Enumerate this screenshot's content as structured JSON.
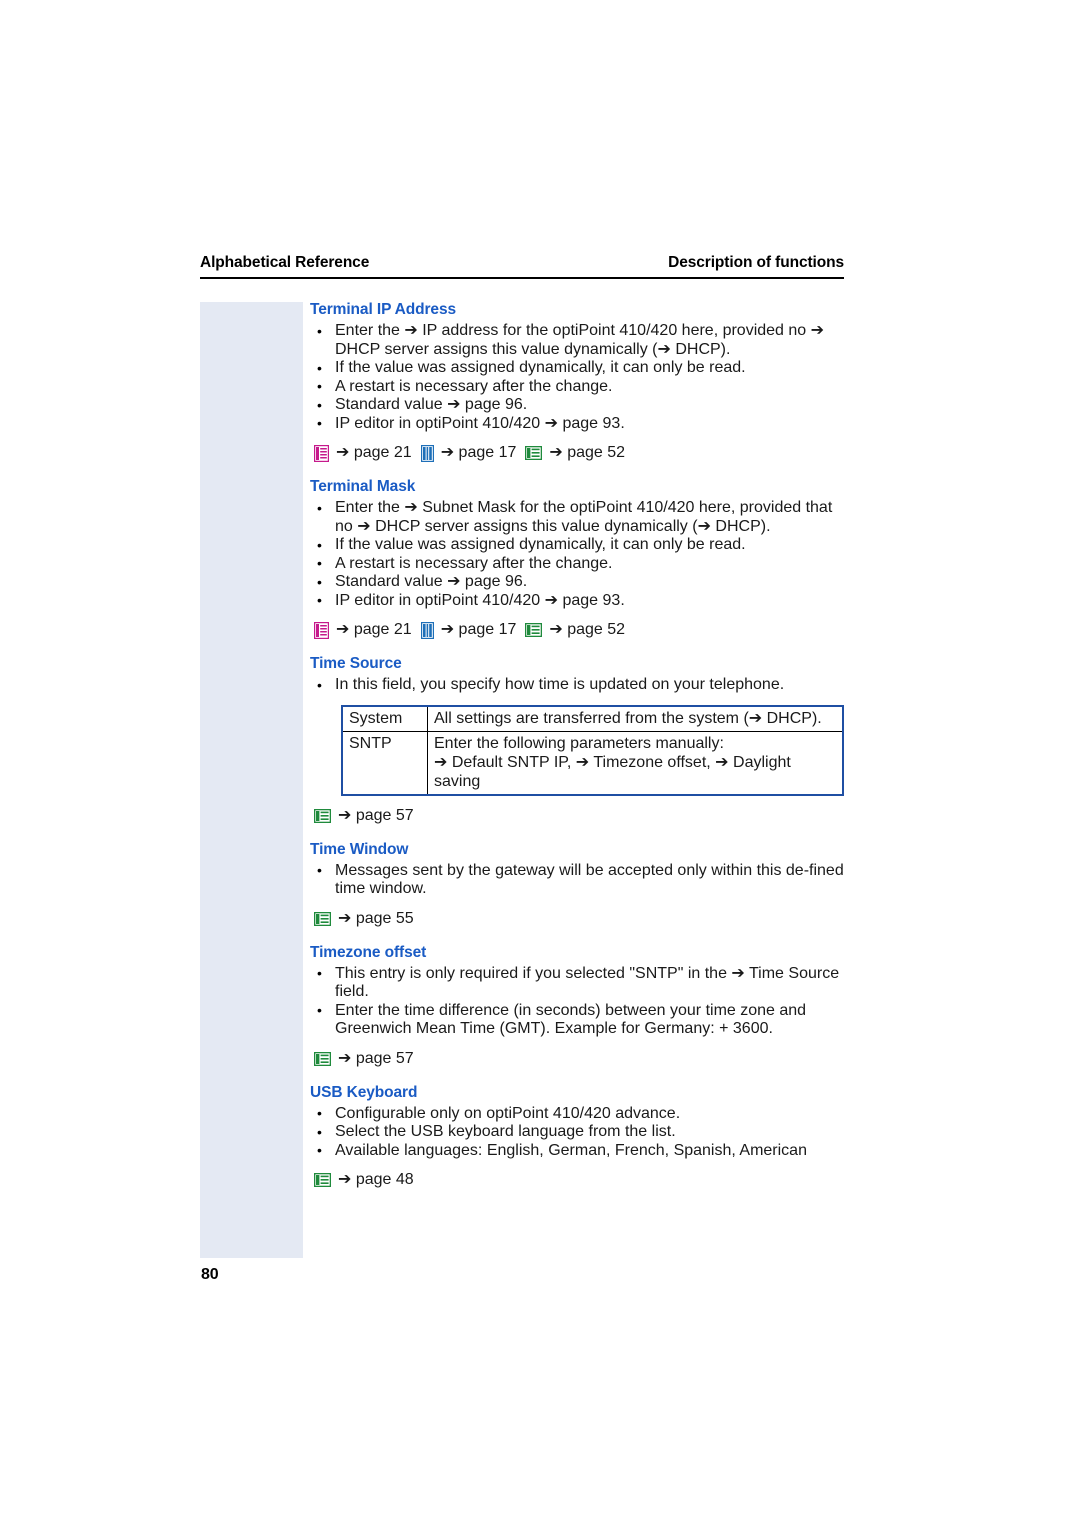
{
  "header": {
    "left": "Alphabetical Reference",
    "right": "Description of functions"
  },
  "folio": "80",
  "colors": {
    "heading_blue": "#1a5bc4",
    "margin_band": "#e4e9f3",
    "table_border": "#1f4fa3",
    "icon_magenta": "#c6198c",
    "icon_blue": "#1e6fb8",
    "icon_green": "#1f8a3c"
  },
  "sections": [
    {
      "title": "Terminal IP Address",
      "bullets": [
        "Enter the ➔ IP address for the optiPoint 410/420 here, provided no ➔ DHCP server assigns this value dynamically (➔ DHCP).",
        "If the value was assigned dynamically, it can only be read.",
        "A restart is necessary after the change.",
        "Standard value ➔ page 96.",
        "IP editor in optiPoint 410/420 ➔ page 93."
      ],
      "xrefs": [
        {
          "icon": "manual-magenta-icon",
          "text": "➔ page 21"
        },
        {
          "icon": "manual-blue-icon",
          "text": "➔ page 17"
        },
        {
          "icon": "manual-green-icon",
          "text": "➔ page 52"
        }
      ]
    },
    {
      "title": "Terminal Mask",
      "bullets": [
        "Enter the ➔ Subnet Mask for the optiPoint 410/420 here, provided that no ➔ DHCP server assigns this value dynamically (➔ DHCP).",
        "If the value was assigned dynamically, it can only be read.",
        "A restart is necessary after the change.",
        "Standard value ➔ page 96.",
        "IP editor in optiPoint 410/420 ➔ page 93."
      ],
      "xrefs": [
        {
          "icon": "manual-magenta-icon",
          "text": "➔ page 21"
        },
        {
          "icon": "manual-blue-icon",
          "text": "➔ page 17"
        },
        {
          "icon": "manual-green-icon",
          "text": "➔ page 52"
        }
      ]
    },
    {
      "title": "Time Source",
      "bullets": [
        "In this field, you specify how time is updated on your telephone."
      ],
      "table": {
        "rows": [
          {
            "key": "System",
            "value": "All settings are transferred from the system (➔ DHCP)."
          },
          {
            "key": "SNTP",
            "value": "Enter the following parameters manually:\n➔ Default SNTP IP, ➔ Timezone offset, ➔ Daylight saving"
          }
        ]
      },
      "xrefs": [
        {
          "icon": "manual-green-icon",
          "text": "➔ page 57"
        }
      ]
    },
    {
      "title": "Time Window",
      "bullets": [
        "Messages sent by the gateway will be accepted only within this de-fined time window."
      ],
      "xrefs": [
        {
          "icon": "manual-green-icon",
          "text": "➔ page 55"
        }
      ]
    },
    {
      "title": "Timezone offset",
      "bullets": [
        "This entry is only required if you selected \"SNTP\" in the ➔ Time Source field.",
        "Enter the time difference (in seconds) between your time zone and Greenwich Mean Time (GMT). Example for Germany: + 3600."
      ],
      "xrefs": [
        {
          "icon": "manual-green-icon",
          "text": "➔ page 57"
        }
      ]
    },
    {
      "title": "USB Keyboard",
      "bullets": [
        "Configurable only on optiPoint 410/420 advance.",
        "Select the USB keyboard language from the list.",
        "Available languages: English, German, French, Spanish, American"
      ],
      "xrefs": [
        {
          "icon": "manual-green-icon",
          "text": "➔ page 48"
        }
      ]
    }
  ]
}
